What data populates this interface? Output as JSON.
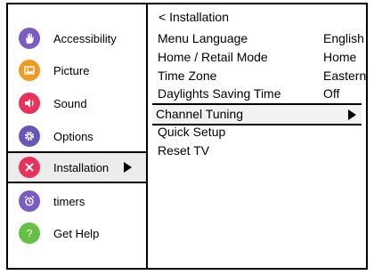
{
  "sidebar": {
    "items": [
      {
        "label": "Accessibility",
        "icon": "hand-icon",
        "color": "#7b5bc4"
      },
      {
        "label": "Picture",
        "icon": "picture-icon",
        "color": "#f29a1f"
      },
      {
        "label": "Sound",
        "icon": "speaker-icon",
        "color": "#e8325a"
      },
      {
        "label": "Options",
        "icon": "gear-icon",
        "color": "#6a55b8"
      },
      {
        "label": "Installation",
        "icon": "tools-icon",
        "color": "#e8325a"
      },
      {
        "label": "timers",
        "icon": "alarm-clock-icon",
        "color": "#7b5bc4"
      },
      {
        "label": "Get Help",
        "icon": "question-icon",
        "color": "#66c045"
      }
    ],
    "selected": "Installation"
  },
  "panel": {
    "back_label": "< Installation",
    "rows": [
      {
        "label": "Menu Language",
        "value": "English"
      },
      {
        "label": "Home / Retail Mode",
        "value": "Home"
      },
      {
        "label": "Time Zone",
        "value": "Eastern"
      },
      {
        "label": "Daylights Saving Time",
        "value": "Off"
      },
      {
        "label": "Channel Tuning",
        "value": ""
      },
      {
        "label": "Quick Setup",
        "value": ""
      },
      {
        "label": "Reset TV",
        "value": ""
      }
    ],
    "selected": "Channel Tuning"
  }
}
